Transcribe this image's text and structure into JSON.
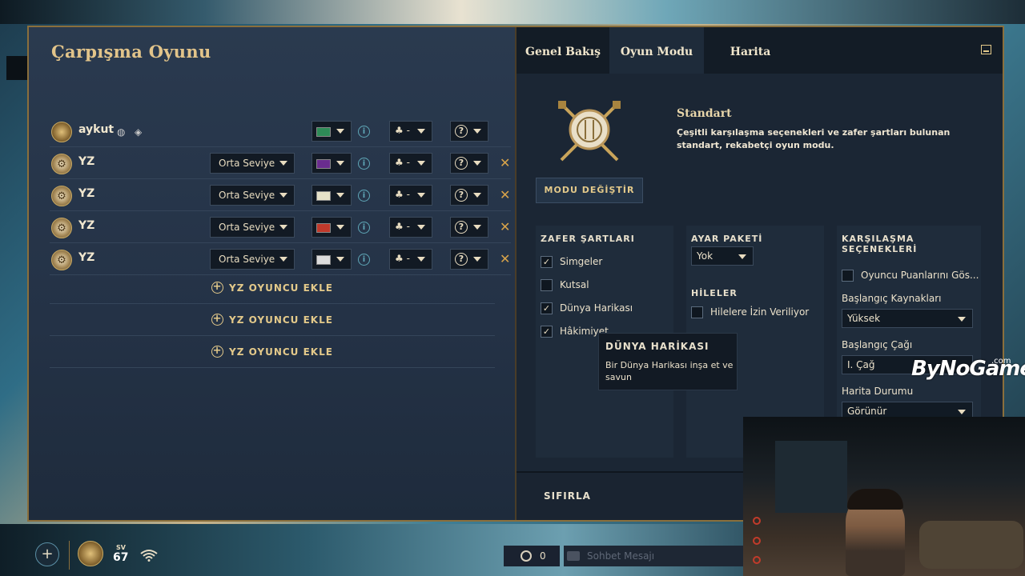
{
  "lobby": {
    "title": "Çarpışma Oyunu",
    "players": [
      {
        "name": "aykut",
        "difficulty": "",
        "flag_color": "#2e8b57",
        "has_remove": false,
        "is_user": true
      },
      {
        "name": "YZ",
        "difficulty": "Orta Seviye",
        "flag_color": "#6a2c8f",
        "has_remove": true,
        "is_user": false
      },
      {
        "name": "YZ",
        "difficulty": "Orta Seviye",
        "flag_color": "#e6e2c8",
        "has_remove": true,
        "is_user": false
      },
      {
        "name": "YZ",
        "difficulty": "Orta Seviye",
        "flag_color": "#c0392b",
        "has_remove": true,
        "is_user": false
      },
      {
        "name": "YZ",
        "difficulty": "Orta Seviye",
        "flag_color": "#dcdcdc",
        "has_remove": true,
        "is_user": false
      }
    ],
    "team_glyph": "-",
    "add_ai_label": "YZ OYUNCU EKLE"
  },
  "tabs": [
    "Genel Bakış",
    "Oyun Modu",
    "Harita"
  ],
  "active_tab": "Oyun Modu",
  "mode": {
    "name": "Standart",
    "description": "Çeşitli karşılaşma seçenekleri ve zafer şartları bulunan standart, rekabetçi oyun modu.",
    "change_button": "MODU DEĞİŞTİR"
  },
  "victory": {
    "header": "ZAFER ŞARTLARI",
    "items": [
      {
        "label": "Simgeler",
        "checked": true
      },
      {
        "label": "Kutsal",
        "checked": false
      },
      {
        "label": "Dünya Harikası",
        "checked": true
      },
      {
        "label": "Hâkimiyet",
        "checked": true
      }
    ]
  },
  "preset": {
    "header": "AYAR PAKETİ",
    "value": "Yok",
    "cheats_header": "HİLELER",
    "cheats_label": "Hilelere İzin Veriliyor",
    "cheats_checked": false
  },
  "match": {
    "header": "KARŞILAŞMA SEÇENEKLERİ",
    "show_scores_label": "Oyuncu Puanlarını Gös...",
    "start_resources_label": "Başlangıç Kaynakları",
    "start_resources_value": "Yüksek",
    "start_age_label": "Başlangıç Çağı",
    "start_age_value": "I. Çağ",
    "map_state_label": "Harita Durumu",
    "map_state_value": "Görünür"
  },
  "tooltip": {
    "title": "DÜNYA HARİKASI",
    "body": "Bir Dünya Harikası inşa et ve savun"
  },
  "reset_label": "SIFIRLA",
  "watermark": {
    "text": "ByNoGame",
    "suffix": ".com"
  },
  "bottom_bar": {
    "sv_label": "SV",
    "sv_value": "67",
    "chat_count": "0",
    "chat_placeholder": "Sohbet Mesajı"
  }
}
